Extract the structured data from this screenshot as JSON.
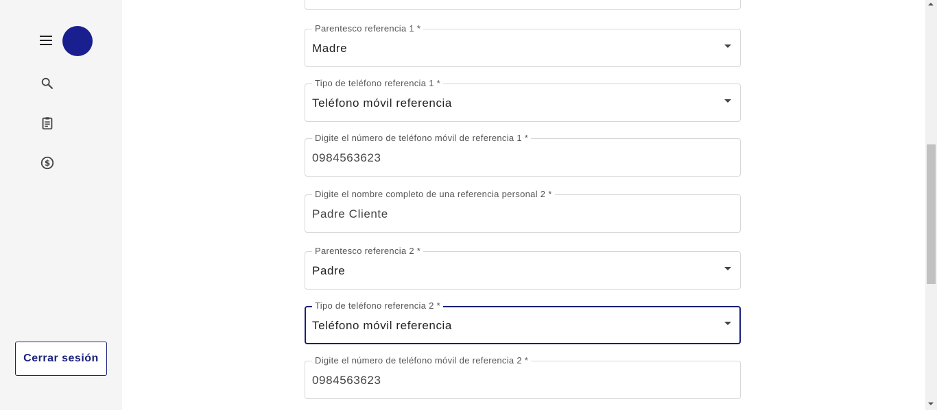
{
  "sidebar": {
    "menu_icon": "menu-icon",
    "avatar_color": "#1a1f8f",
    "nav_items": [
      {
        "icon": "search-icon"
      },
      {
        "icon": "clipboard-icon"
      },
      {
        "icon": "dollar-icon"
      }
    ],
    "logout_label": "Cerrar sesión"
  },
  "form": {
    "fields": [
      {
        "label": "Parentesco referencia 1 *",
        "value": "Madre",
        "type": "select"
      },
      {
        "label": "Tipo de teléfono referencia 1 *",
        "value": "Teléfono móvil referencia",
        "type": "select"
      },
      {
        "label": "Digite el número de teléfono móvil de referencia 1 *",
        "value": "0984563623",
        "type": "input"
      },
      {
        "label": "Digite el nombre completo de una referencia personal 2 *",
        "value": "Padre Cliente",
        "type": "input"
      },
      {
        "label": "Parentesco referencia 2 *",
        "value": "Padre",
        "type": "select"
      },
      {
        "label": "Tipo de teléfono referencia 2 *",
        "value": "Teléfono móvil referencia",
        "type": "select",
        "focused": true
      },
      {
        "label": "Digite el número de teléfono móvil de referencia 2 *",
        "value": "0984563623",
        "type": "input"
      }
    ]
  },
  "colors": {
    "accent": "#1a1f7a",
    "sidebar_bg": "#f5f5f5",
    "border": "#d6d6d6"
  }
}
